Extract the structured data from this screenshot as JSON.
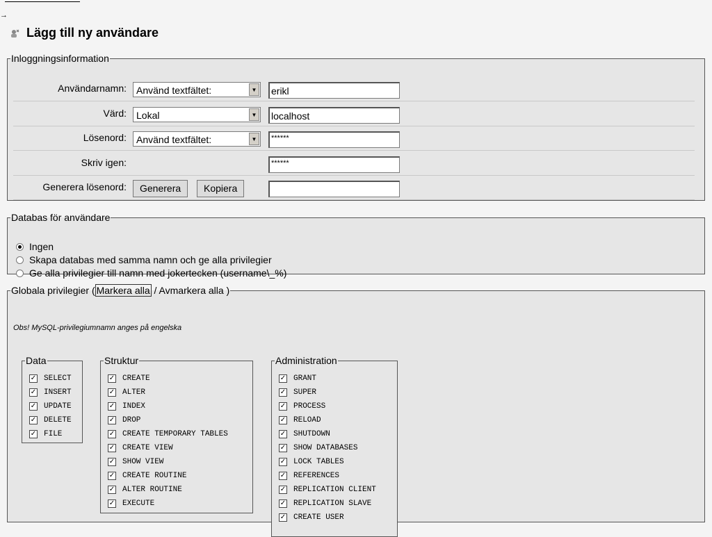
{
  "page": {
    "title": "Lägg till ny användare",
    "arrow_glyph": "→"
  },
  "login": {
    "legend": "Inloggningsinformation",
    "username": {
      "label": "Användarnamn:",
      "select": "Använd textfältet:",
      "value": "erikl"
    },
    "host": {
      "label": "Värd:",
      "select": "Lokal",
      "value": "localhost"
    },
    "password": {
      "label": "Lösenord:",
      "select": "Använd textfältet:",
      "value": "******"
    },
    "retype": {
      "label": "Skriv igen:",
      "value": "******"
    },
    "generate": {
      "label": "Generera lösenord:",
      "generate_button": "Generera",
      "copy_button": "Kopiera",
      "value": ""
    }
  },
  "database": {
    "legend": "Databas för användare",
    "options": [
      {
        "label": "Ingen",
        "checked": true
      },
      {
        "label": "Skapa databas med samma namn och ge alla privilegier",
        "checked": false
      },
      {
        "label": "Ge alla privilegier till namn med jokertecken (username\\_%)",
        "checked": false
      }
    ]
  },
  "global": {
    "legend_prefix": "Globala privilegier (",
    "check_all": "Markera alla",
    "separator": " / ",
    "uncheck_all": "Avmarkera alla",
    "legend_suffix": " )",
    "note": "Obs! MySQL-privilegiumnamn anges på engelska",
    "groups": {
      "data": {
        "legend": "Data",
        "items": [
          "SELECT",
          "INSERT",
          "UPDATE",
          "DELETE",
          "FILE"
        ]
      },
      "structure": {
        "legend": "Struktur",
        "items": [
          "CREATE",
          "ALTER",
          "INDEX",
          "DROP",
          "CREATE TEMPORARY TABLES",
          "CREATE VIEW",
          "SHOW VIEW",
          "CREATE ROUTINE",
          "ALTER ROUTINE",
          "EXECUTE"
        ]
      },
      "admin": {
        "legend": "Administration",
        "items": [
          "GRANT",
          "SUPER",
          "PROCESS",
          "RELOAD",
          "SHUTDOWN",
          "SHOW DATABASES",
          "LOCK TABLES",
          "REFERENCES",
          "REPLICATION CLIENT",
          "REPLICATION SLAVE",
          "CREATE USER"
        ]
      }
    }
  }
}
